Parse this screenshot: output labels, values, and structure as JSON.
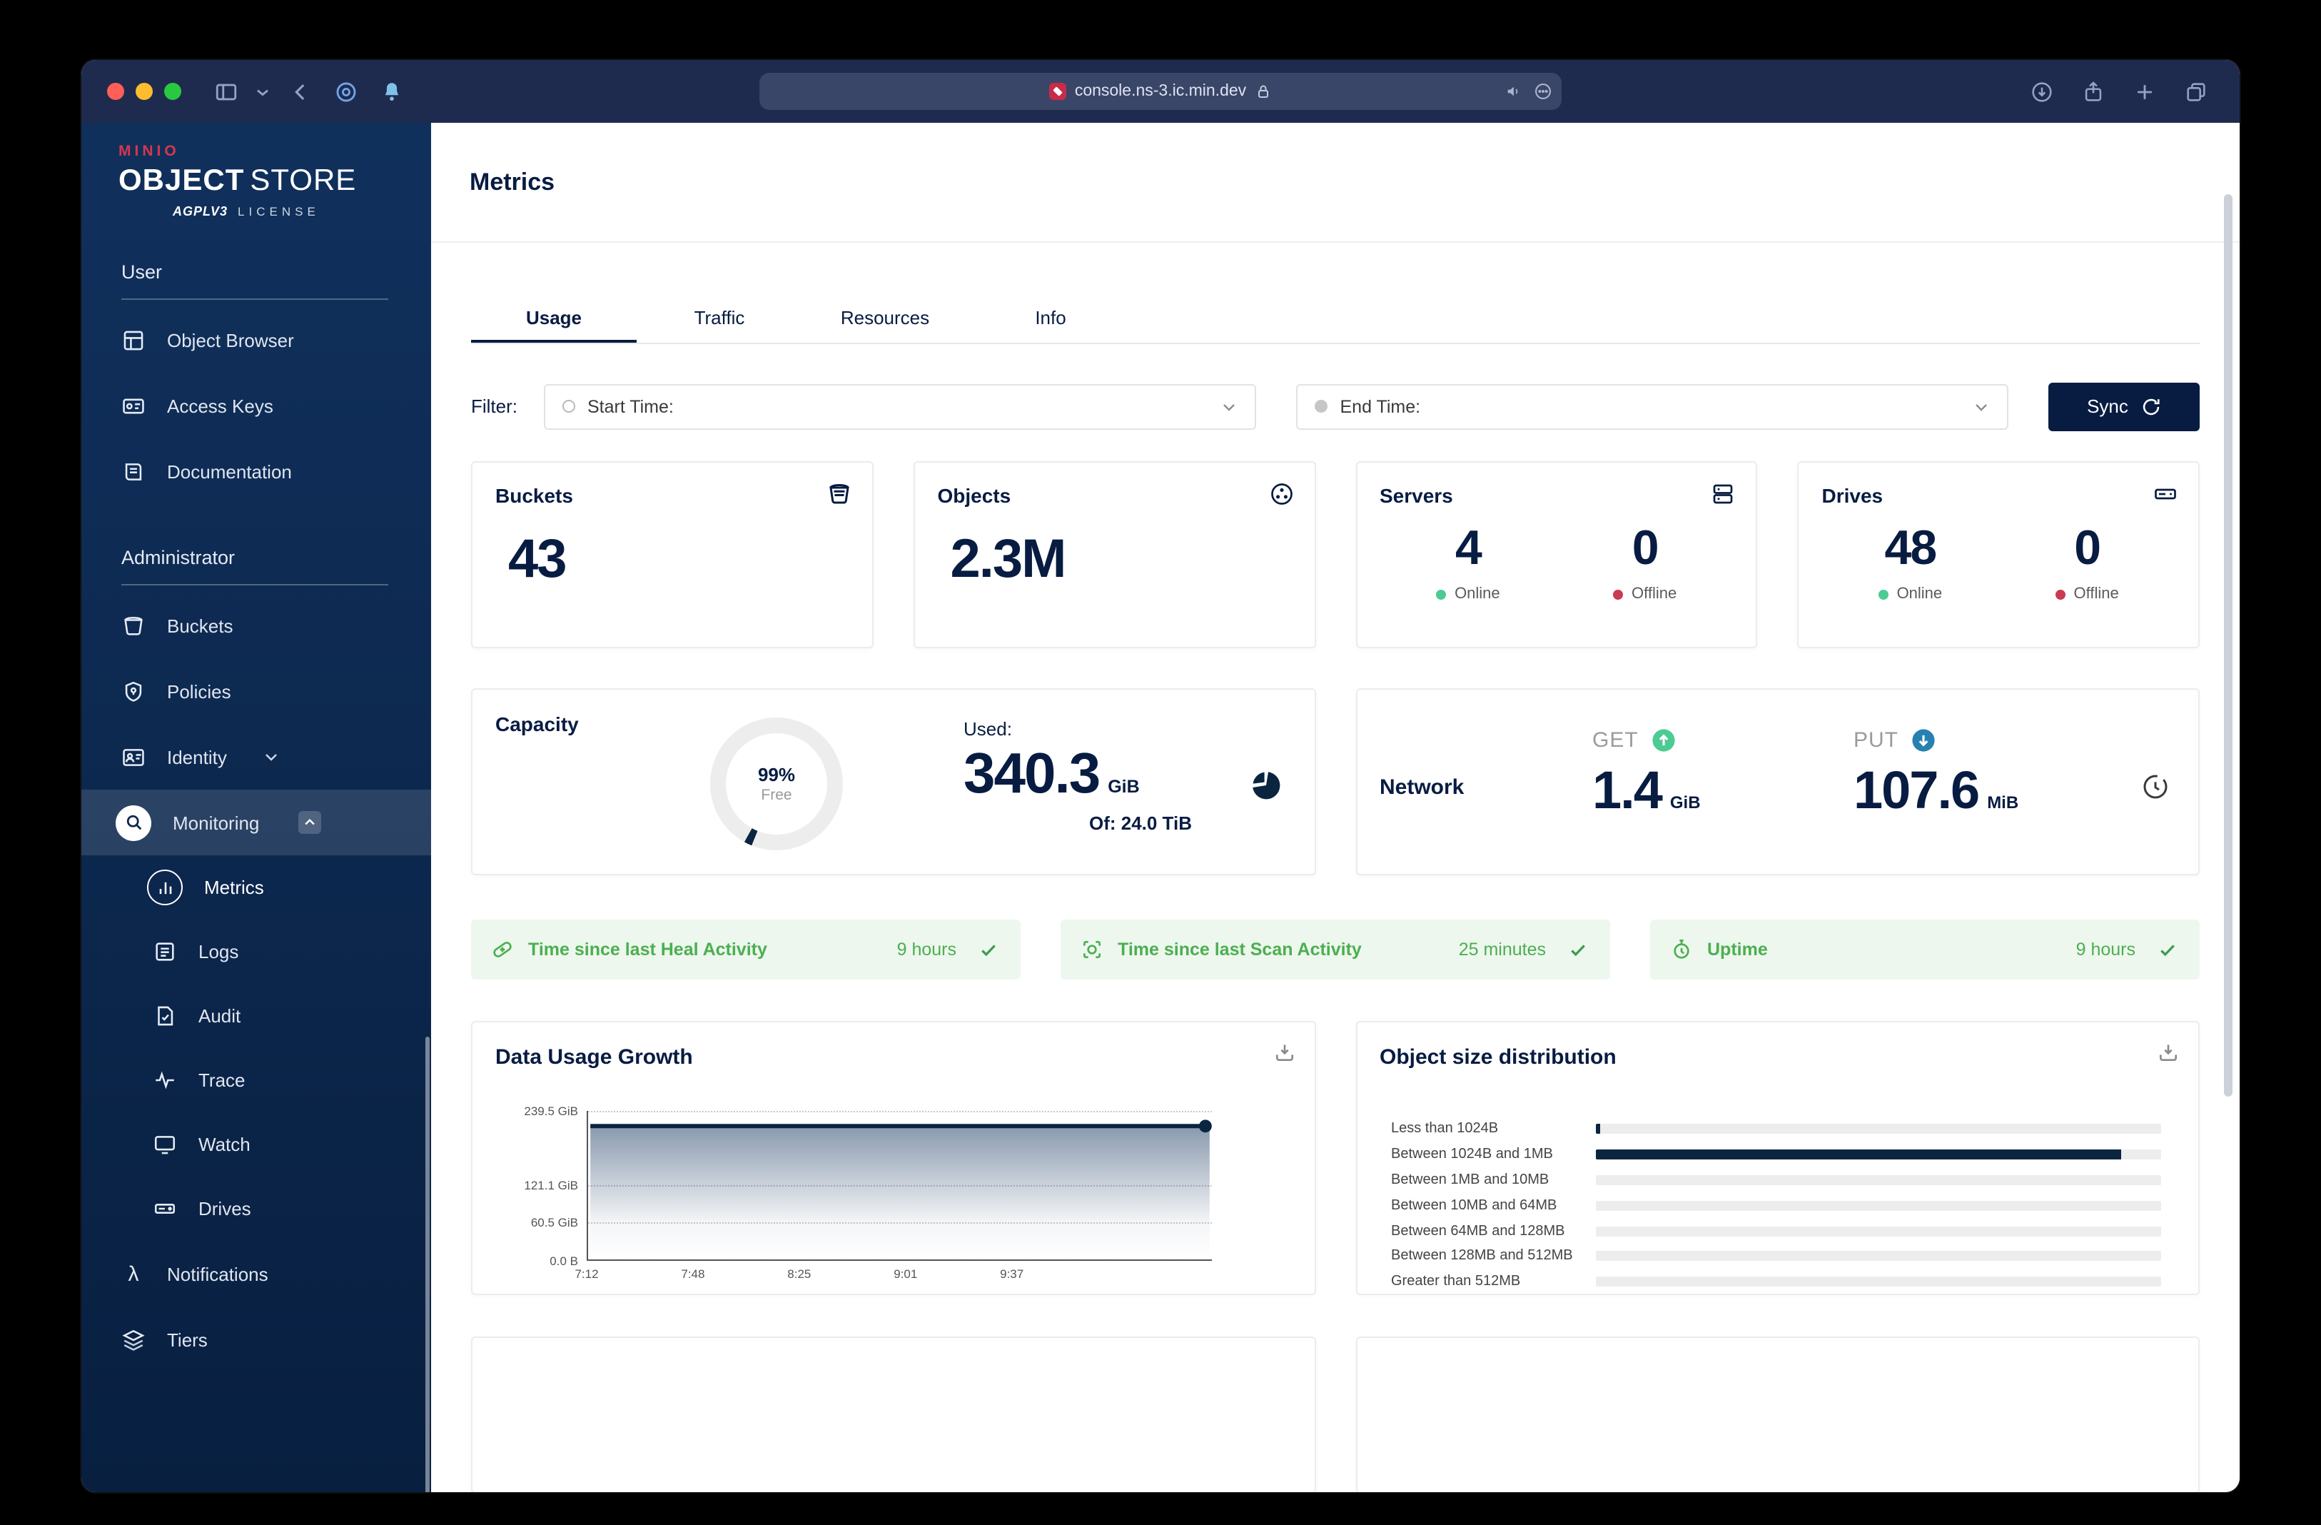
{
  "browser": {
    "url": "console.ns-3.ic.min.dev"
  },
  "sidebar": {
    "logo": {
      "brand": "MINIO",
      "title_bold": "OBJECT",
      "title_light": "STORE",
      "license_mark": "AGPLV3",
      "license": "LICENSE"
    },
    "sections": [
      {
        "label": "User",
        "items": [
          {
            "label": "Object Browser",
            "icon": "object-browser-icon"
          },
          {
            "label": "Access Keys",
            "icon": "access-keys-icon"
          },
          {
            "label": "Documentation",
            "icon": "documentation-icon"
          }
        ]
      },
      {
        "label": "Administrator",
        "items": [
          {
            "label": "Buckets",
            "icon": "buckets-icon"
          },
          {
            "label": "Policies",
            "icon": "policies-icon"
          },
          {
            "label": "Identity",
            "icon": "identity-icon",
            "chevron": "down"
          },
          {
            "label": "Monitoring",
            "icon": "monitoring-icon",
            "chevron": "up",
            "active": true,
            "children": [
              {
                "label": "Metrics",
                "icon": "metrics-icon",
                "active": true
              },
              {
                "label": "Logs",
                "icon": "logs-icon"
              },
              {
                "label": "Audit",
                "icon": "audit-icon"
              },
              {
                "label": "Trace",
                "icon": "trace-icon"
              },
              {
                "label": "Watch",
                "icon": "watch-icon"
              },
              {
                "label": "Drives",
                "icon": "drives-icon"
              }
            ]
          },
          {
            "label": "Notifications",
            "icon": "notifications-icon"
          },
          {
            "label": "Tiers",
            "icon": "tiers-icon"
          }
        ]
      }
    ]
  },
  "page": {
    "title": "Metrics",
    "tabs": [
      {
        "label": "Usage",
        "active": true
      },
      {
        "label": "Traffic"
      },
      {
        "label": "Resources"
      },
      {
        "label": "Info"
      }
    ],
    "filter": {
      "label": "Filter:",
      "start_label": "Start Time:",
      "end_label": "End Time:",
      "sync_label": "Sync"
    }
  },
  "cards": {
    "buckets": {
      "title": "Buckets",
      "value": "43"
    },
    "objects": {
      "title": "Objects",
      "value": "2.3M"
    },
    "servers": {
      "title": "Servers",
      "online_value": "4",
      "online_label": "Online",
      "offline_value": "0",
      "offline_label": "Offline"
    },
    "drives": {
      "title": "Drives",
      "online_value": "48",
      "online_label": "Online",
      "offline_value": "0",
      "offline_label": "Offline"
    },
    "capacity": {
      "title": "Capacity",
      "donut_pct": "99%",
      "donut_label": "Free",
      "used_label": "Used:",
      "used_value": "340.3",
      "used_unit": "GiB",
      "total": "Of: 24.0 TiB"
    },
    "network": {
      "title": "Network",
      "get_label": "GET",
      "get_value": "1.4",
      "get_unit": "GiB",
      "put_label": "PUT",
      "put_value": "107.6",
      "put_unit": "MiB"
    }
  },
  "status_bars": [
    {
      "label": "Time since last Heal Activity",
      "value": "9 hours",
      "icon": "heal-icon"
    },
    {
      "label": "Time since last Scan Activity",
      "value": "25 minutes",
      "icon": "scan-icon"
    },
    {
      "label": "Uptime",
      "value": "9 hours",
      "icon": "uptime-icon"
    }
  ],
  "colors": {
    "accent_navy": "#081C42",
    "green": "#4CCB92",
    "red": "#C83B51",
    "put_blue": "#2781B0",
    "status_green": "#4caf50"
  },
  "chart_data": [
    {
      "type": "area",
      "title": "Data Usage Growth",
      "x": [
        "7:12",
        "7:48",
        "8:25",
        "9:01",
        "9:37"
      ],
      "series": [
        {
          "name": "Data Usage",
          "values": [
            215,
            215,
            215,
            215,
            215
          ]
        }
      ],
      "y_ticks": [
        {
          "label": "239.5 GiB",
          "value": 239.5
        },
        {
          "label": "121.1 GiB",
          "value": 121.1
        },
        {
          "label": "60.5 GiB",
          "value": 60.5
        },
        {
          "label": "0.0 B",
          "value": 0
        }
      ],
      "ylim": [
        0,
        239.5
      ],
      "grid": true,
      "legend": false,
      "note": "flat line extends beyond last x tick, dot marker at right end"
    },
    {
      "type": "bar",
      "orientation": "horizontal",
      "title": "Object size distribution",
      "categories": [
        "Less than 1024B",
        "Between 1024B and 1MB",
        "Between 1MB and 10MB",
        "Between 10MB and 64MB",
        "Between 64MB and 128MB",
        "Between 128MB and 512MB",
        "Greater than 512MB"
      ],
      "values": [
        0.8,
        93,
        0,
        0,
        0,
        0,
        0
      ],
      "xlim": [
        0,
        100
      ],
      "unit": "% of track width"
    }
  ]
}
